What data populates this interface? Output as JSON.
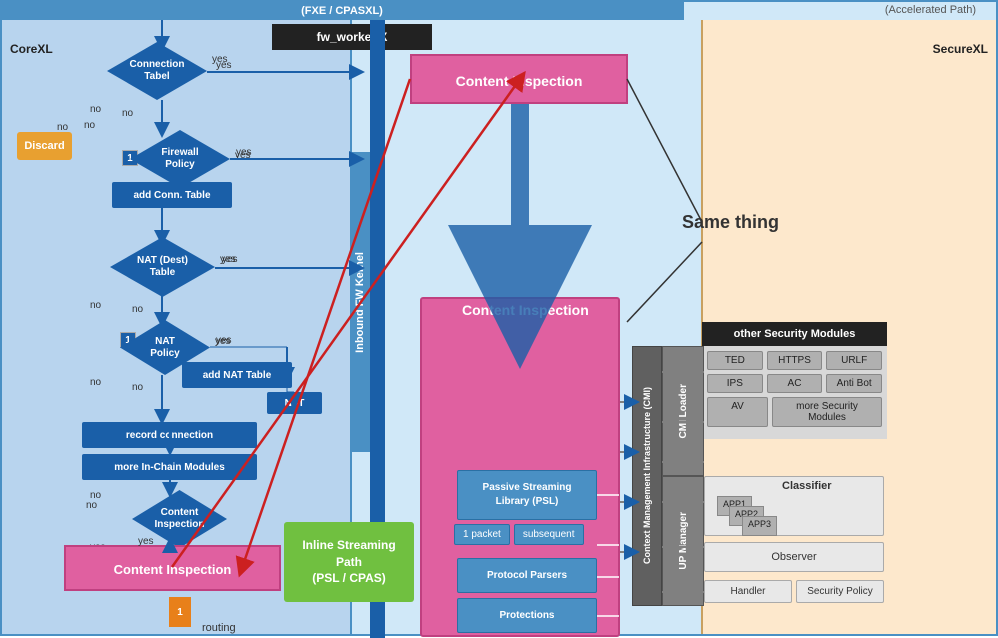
{
  "header": {
    "left_label": "(FXE / CPASXL)",
    "right_label": "(Accelerated Path)"
  },
  "sections": {
    "corexl": "CoreXL",
    "securexl": "SecureXL"
  },
  "fw_worker": "fw_worker X",
  "content_inspection_top": "Content Inspection",
  "content_inspection_mid": "Content Inspection",
  "content_inspection_bottom": "Content Inspection",
  "inbound_fw_kernel": "Inbound FW Kernel",
  "inline_streaming": "Inline Streaming\nPath\n(PSL / CPAS)",
  "inline_streaming_line1": "Inline Streaming",
  "inline_streaming_line2": "Path",
  "inline_streaming_line3": "(PSL / CPAS)",
  "same_thing": "Same thing",
  "other_security_modules": "other Security Modules",
  "cmi_loader": "CMI Loader",
  "cmi_full": "Context Management Infrastructure (CMI)",
  "up_manager": "UP Manager",
  "flowchart": {
    "connection_table": "Connection\nTabel",
    "yes1": "yes",
    "no1": "no",
    "no2": "no",
    "firewall_policy": "Firewall\nPolicy",
    "yes_fw": "yes",
    "add_conn": "add Conn. Table",
    "nat_dest": "NAT (Dest)\nTable",
    "yes2": "yes",
    "no3": "no",
    "nat_policy": "NAT\nPolicy",
    "yes3": "yes",
    "no4": "no",
    "add_nat": "add NAT Table",
    "nat": "NAT",
    "record_conn": "record connection",
    "more_chain": "more In-Chain Modules",
    "content_insp_diamond": "Content\nInspection",
    "no5": "no",
    "yes4": "yes",
    "num1": "1",
    "num2": "1"
  },
  "modules": {
    "row1": [
      "TED",
      "HTTPS",
      "URLF"
    ],
    "row2": [
      "IPS",
      "AC",
      "Anti Bot"
    ],
    "row3": [
      "AV",
      "more Security Modules"
    ],
    "classifier": "Classifier",
    "app1": "APP1",
    "app2": "APP2",
    "app3": "APP3",
    "observer": "Observer",
    "handler": "Handler",
    "security_policy": "Security Policy"
  },
  "psl": {
    "label": "Passive Streaming\nLibrary (PSL)",
    "line1": "Passive Streaming",
    "line2": "Library (PSL)",
    "packet1": "1 packet",
    "subsequent": "subsequent"
  },
  "protocol_parsers": "Protocol Parsers",
  "protections": "Protections",
  "discard": "Discard",
  "routing": "routing",
  "orange_num": "1",
  "colors": {
    "blue": "#1a5fa8",
    "pink": "#e060a0",
    "green": "#70c040",
    "orange": "#e8a030",
    "dark": "#222222",
    "light_blue_bg": "#b8d4ee",
    "peach_bg": "#fde8cc"
  }
}
